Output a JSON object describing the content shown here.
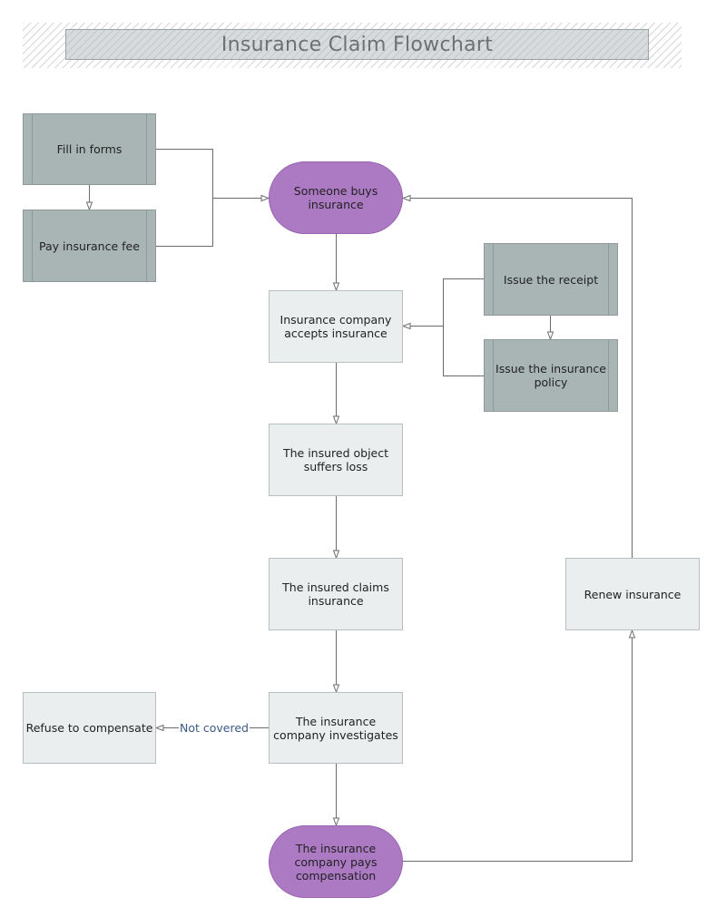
{
  "title": "Insurance Claim Flowchart",
  "colors": {
    "terminal": "#ac79c3",
    "process": "#eaeeef",
    "subprocess": "#a9b5b4",
    "connector": "#6b6b6b",
    "edge_label": "#3b5a85"
  },
  "nodes": {
    "fill_forms": "Fill in forms",
    "pay_fee": "Pay insurance fee",
    "buys": "Someone buys insurance",
    "accepts": "Insurance company accepts insurance",
    "receipt": "Issue the receipt",
    "policy": "Issue the insurance policy",
    "loss": "The insured object suffers loss",
    "claims": "The insured claims insurance",
    "investigates": "The insurance company investigates",
    "refuse": "Refuse to compensate",
    "pays": "The insurance company pays compensation",
    "renew": "Renew insurance"
  },
  "edges": [
    {
      "from": "fill_forms",
      "to": "pay_fee",
      "label": ""
    },
    {
      "from": "fill_forms",
      "to": "buys",
      "label": ""
    },
    {
      "from": "pay_fee",
      "to": "buys",
      "label": ""
    },
    {
      "from": "buys",
      "to": "accepts",
      "label": ""
    },
    {
      "from": "receipt",
      "to": "policy",
      "label": ""
    },
    {
      "from": "receipt",
      "to": "accepts",
      "label": ""
    },
    {
      "from": "policy",
      "to": "accepts",
      "label": ""
    },
    {
      "from": "accepts",
      "to": "loss",
      "label": ""
    },
    {
      "from": "loss",
      "to": "claims",
      "label": ""
    },
    {
      "from": "claims",
      "to": "investigates",
      "label": ""
    },
    {
      "from": "investigates",
      "to": "refuse",
      "label": "Not covered"
    },
    {
      "from": "investigates",
      "to": "pays",
      "label": ""
    },
    {
      "from": "pays",
      "to": "renew",
      "label": ""
    },
    {
      "from": "renew",
      "to": "buys",
      "label": ""
    }
  ]
}
